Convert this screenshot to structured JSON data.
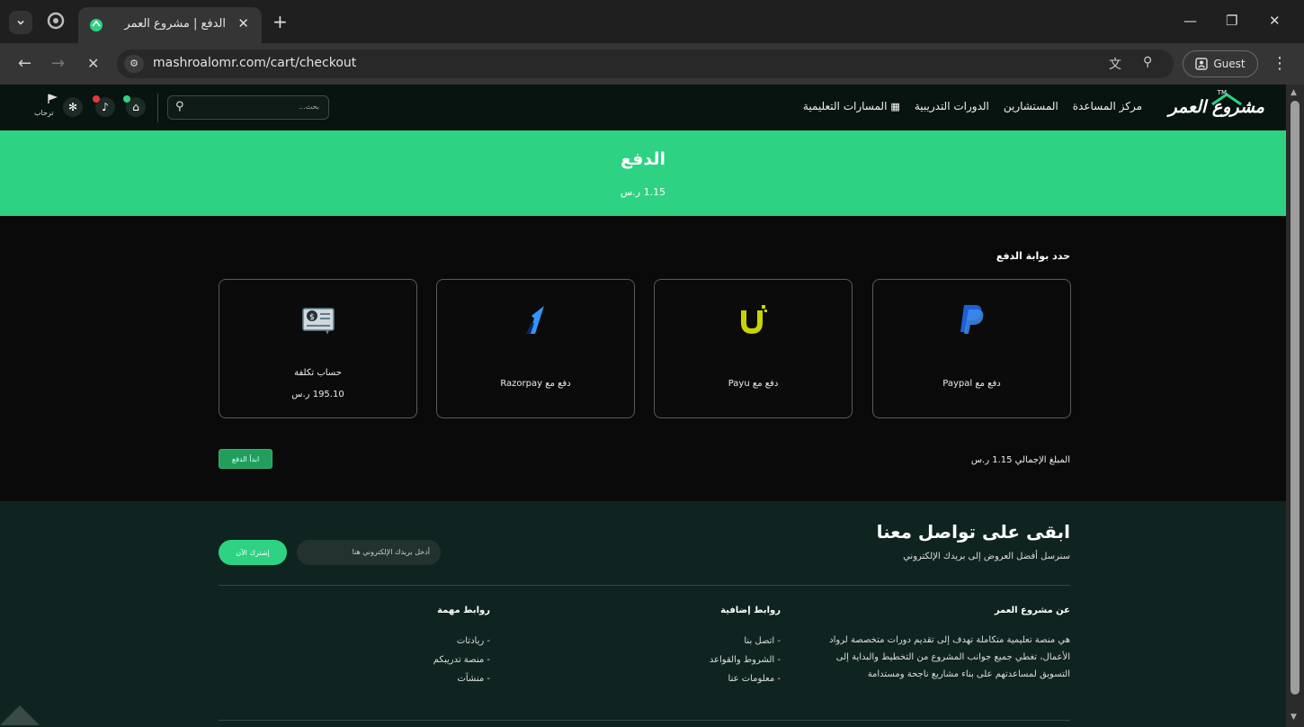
{
  "browser": {
    "tab_title": "الدفع | مشروع العمر",
    "tab_close": "✕",
    "new_tab": "+",
    "url": "mashroalomr.com/cart/checkout",
    "guest_label": "Guest",
    "win_min": "—",
    "win_restore": "❐",
    "win_close": "✕",
    "back": "←",
    "forward": "→",
    "reload": "✕",
    "kebab": "⋮"
  },
  "header": {
    "logo_text": "مشروع العمر",
    "logo_tm": "TM",
    "nav": [
      {
        "label": "المسارات التعليمية"
      },
      {
        "label": "الدورات التدريبية"
      },
      {
        "label": "المستشارين"
      },
      {
        "label": "مركز المساعدة"
      }
    ],
    "search_placeholder": "بحث...",
    "user_label": "ترحاب"
  },
  "hero": {
    "title": "الدفع",
    "amount": "1.15 ر.س"
  },
  "checkout": {
    "section_title": "حدد بوابة الدفع",
    "gateways": [
      {
        "label": "دفع مع Paypal",
        "icon": "paypal-icon"
      },
      {
        "label": "دفع مع Payu",
        "icon": "payu-icon"
      },
      {
        "label": "دفع مع Razorpay",
        "icon": "razorpay-icon"
      },
      {
        "label": "حساب تكلفة",
        "sub": "195.10 ر.س",
        "icon": "cheque-icon"
      }
    ],
    "total": "المبلغ الإجمالي 1.15 ر.س",
    "pay_button": "ابدأ الدفع"
  },
  "footer": {
    "title": "ابقى على تواصل معنا",
    "subtitle": "سنرسل أفضل العروض إلى بريدك الإلكتروني",
    "email_placeholder": "أدخل بريدك الإلكتروني هنا",
    "subscribe": "إشترك الآن",
    "about_title": "عن مشروع العمر",
    "about_text": "هي منصة تعليمية متكاملة تهدف إلى تقديم دورات متخصصة لرواد الأعمال، تغطي جميع جوانب المشروع من التخطيط والبداية إلى التسويق لمساعدتهم على بناء مشاريع ناجحة ومستدامة",
    "links_title": "روابط إضافية",
    "links": [
      "- اتصل بنا",
      "- الشروط والقواعد",
      "- معلومات عنا"
    ],
    "important_title": "روابط مهمة",
    "important": [
      "- ريادتات",
      "- منصة تدريبكم",
      "- منشآت"
    ]
  },
  "colors": {
    "accent": "#2dd282",
    "header_bg": "#081410",
    "footer_bg": "#0f2420",
    "pay_button": "#1f9f5b"
  }
}
